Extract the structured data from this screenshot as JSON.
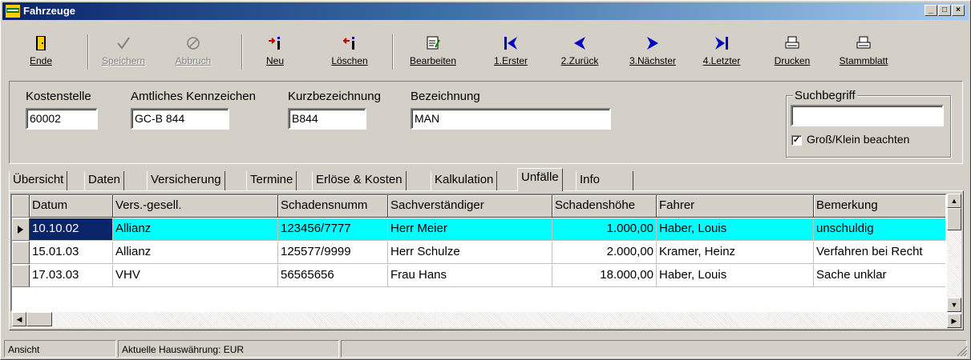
{
  "window": {
    "title": "Fahrzeuge"
  },
  "toolbar": {
    "ende": "Ende",
    "speichern": "Speichern",
    "abbruch": "Abbruch",
    "neu": "Neu",
    "loeschen": "Löschen",
    "bearbeiten": "Bearbeiten",
    "erster": "1.Erster",
    "zurueck": "2.Zurück",
    "naechster": "3.Nächster",
    "letzter": "4.Letzter",
    "drucken": "Drucken",
    "stammblatt": "Stammblatt"
  },
  "fields": {
    "kostenstelle_label": "Kostenstelle",
    "kostenstelle_value": "60002",
    "kennzeichen_label": "Amtliches Kennzeichen",
    "kennzeichen_value": "GC-B 844",
    "kurzbezeichnung_label": "Kurzbezeichnung",
    "kurzbezeichnung_value": "B844",
    "bezeichnung_label": "Bezeichnung",
    "bezeichnung_value": "MAN"
  },
  "search": {
    "title": "Suchbegriff",
    "value": "",
    "case_label": "Groß/Klein beachten",
    "case_checked": true
  },
  "tabs": [
    "Übersicht",
    "Daten",
    "Versicherung",
    "Termine",
    "Erlöse & Kosten",
    "Kalkulation",
    "Unfälle",
    "Info"
  ],
  "active_tab": "Unfälle",
  "grid": {
    "columns": [
      "Datum",
      "Vers.-gesell.",
      "Schadensnumm",
      "Sachverständiger",
      "Schadenshöhe",
      "Fahrer",
      "Bemerkung"
    ],
    "rows": [
      [
        "10.10.02",
        "Allianz",
        "123456/7777",
        "Herr Meier",
        "1.000,00",
        "Haber, Louis",
        "unschuldig"
      ],
      [
        "15.01.03",
        "Allianz",
        "125577/9999",
        "Herr Schulze",
        "2.000,00",
        "Kramer, Heinz",
        "Verfahren bei Recht"
      ],
      [
        "17.03.03",
        "VHV",
        "56565656",
        "Frau Hans",
        "18.000,00",
        "Haber, Louis",
        "Sache unklar"
      ]
    ],
    "selected_row": 0
  },
  "status": {
    "mode": "Ansicht",
    "currency": "Aktuelle Hauswährung: EUR"
  }
}
